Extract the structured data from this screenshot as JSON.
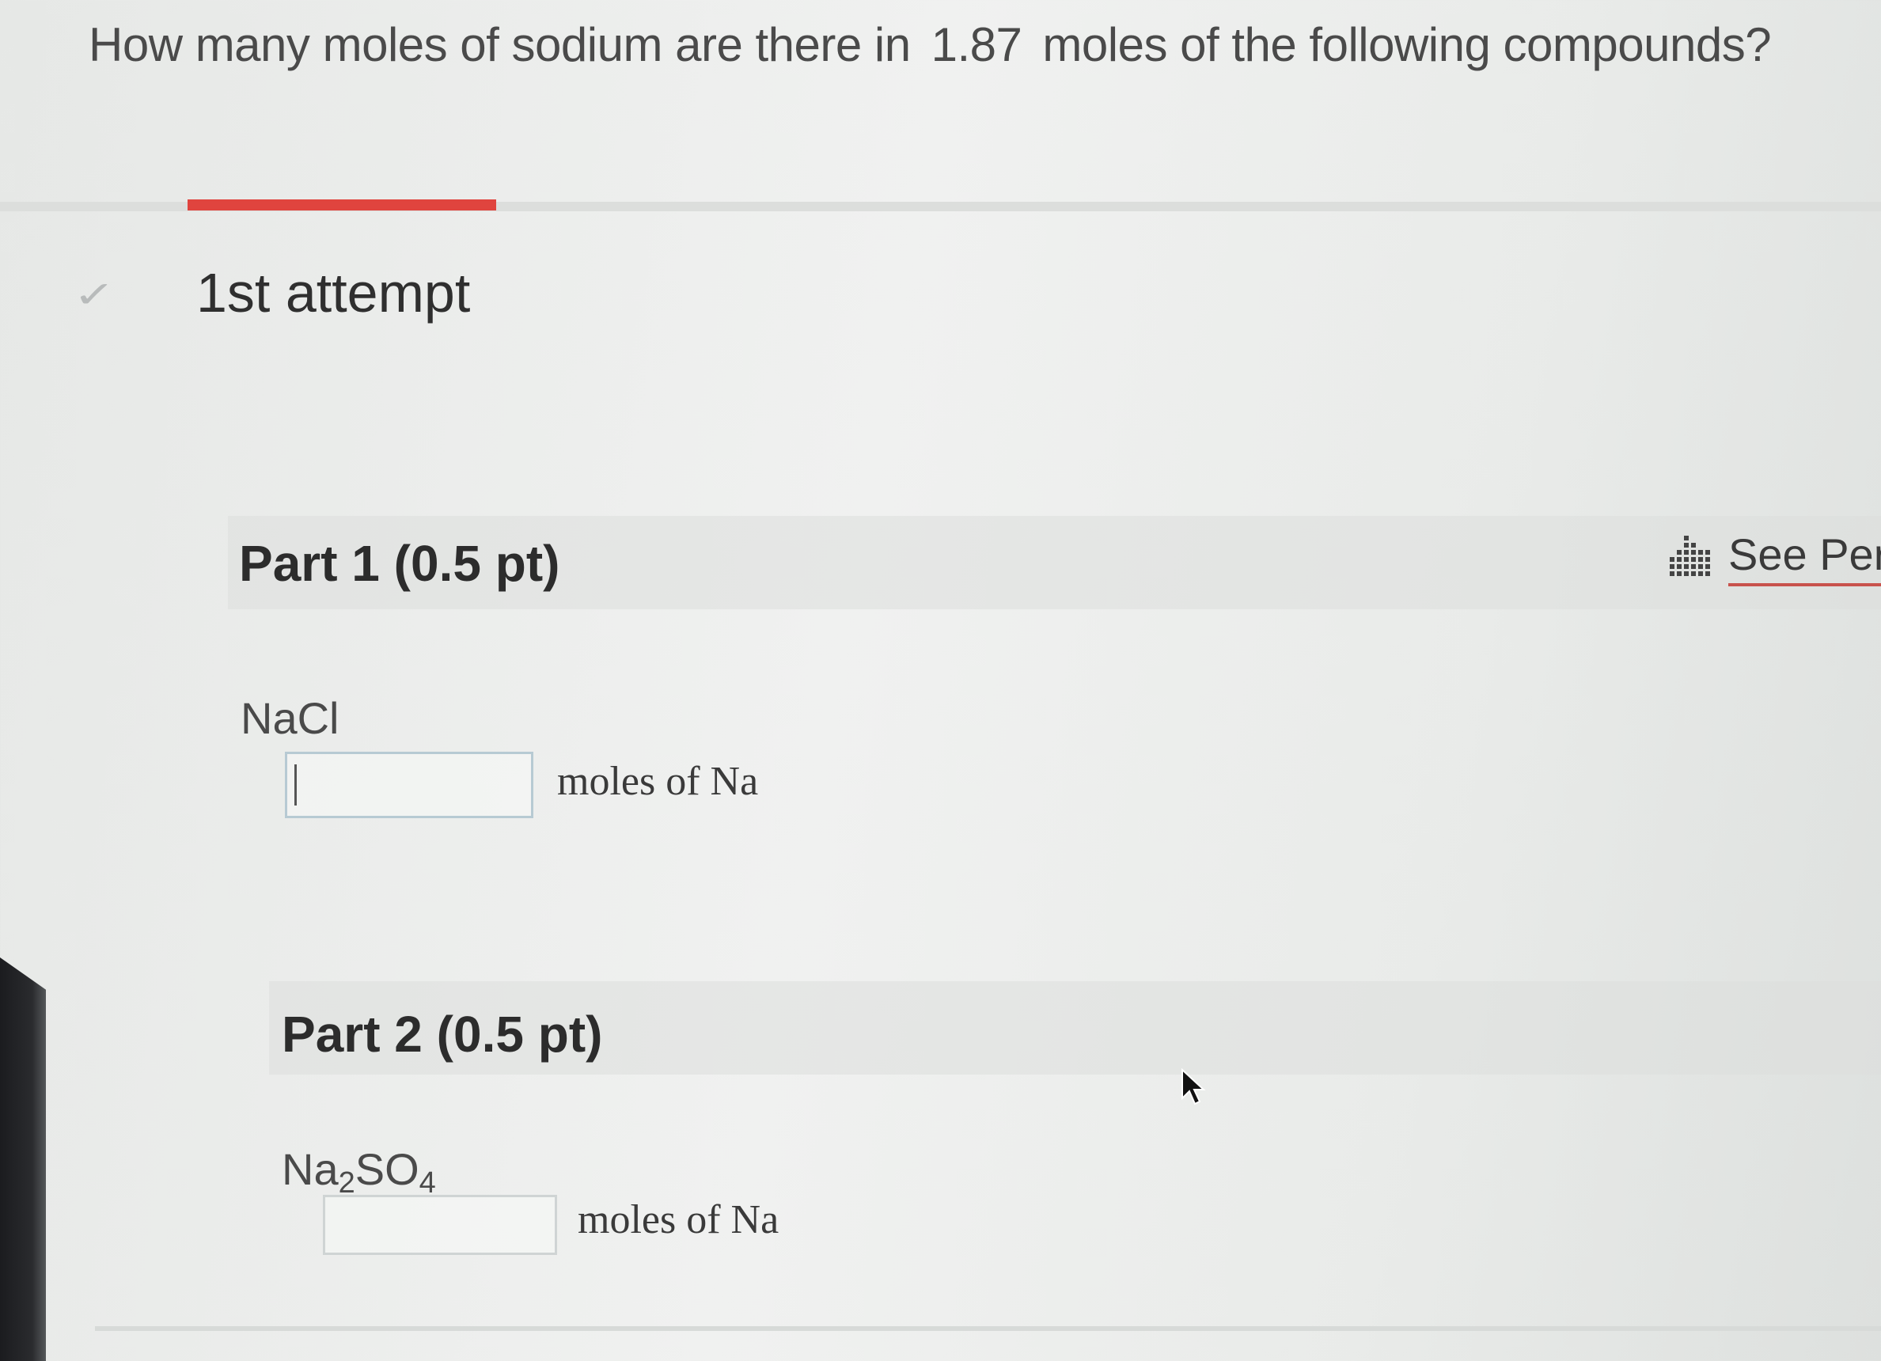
{
  "question": {
    "prefix": "How many moles of sodium are there in",
    "amount": "1.87",
    "suffix": "moles of the following compounds?"
  },
  "attempt": {
    "title": "1st attempt",
    "tab_color": "#e0443e"
  },
  "periodic_table": {
    "label": "See Peri",
    "icon": "periodic-table-icon"
  },
  "parts": [
    {
      "title": "Part 1 (0.5 pt)",
      "compound_main": "NaCl",
      "answer_value": "",
      "unit": "moles of Na"
    },
    {
      "title": "Part 2 (0.5 pt)",
      "compound_pre": "Na",
      "compound_sub1": "2",
      "compound_mid": "SO",
      "compound_sub2": "4",
      "answer_value": "",
      "unit": "moles of Na"
    }
  ]
}
